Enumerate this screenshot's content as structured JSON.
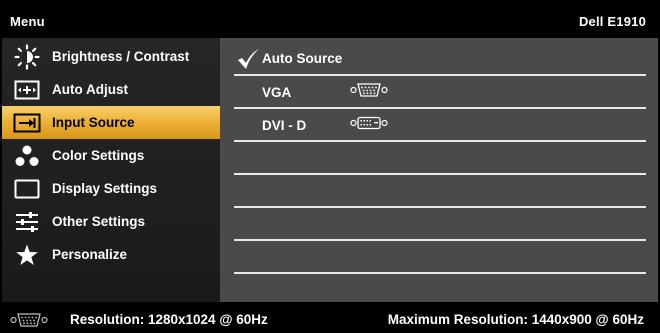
{
  "header": {
    "menu_title": "Menu",
    "model": "Dell  E1910"
  },
  "sidebar": {
    "items": [
      {
        "label": "Brightness / Contrast",
        "icon": "brightness-icon"
      },
      {
        "label": "Auto Adjust",
        "icon": "auto-adjust-icon"
      },
      {
        "label": "Input Source",
        "icon": "input-source-icon",
        "selected": true
      },
      {
        "label": "Color Settings",
        "icon": "color-settings-icon"
      },
      {
        "label": "Display Settings",
        "icon": "display-settings-icon"
      },
      {
        "label": "Other Settings",
        "icon": "other-settings-icon"
      },
      {
        "label": "Personalize",
        "icon": "star-icon"
      }
    ]
  },
  "input_source": {
    "options": [
      {
        "label": "Auto Source",
        "checked": true
      },
      {
        "label": "VGA",
        "connector_icon": "vga-connector-icon"
      },
      {
        "label": "DVI - D",
        "connector_icon": "dvi-connector-icon"
      }
    ]
  },
  "status": {
    "connector_icon": "vga-connector-icon",
    "resolution": "Resolution: 1280x1024 @ 60Hz",
    "max_resolution": "Maximum Resolution: 1440x900 @ 60Hz"
  },
  "colors": {
    "highlight": "#eeb23a",
    "content_bg": "#4a4a4a",
    "sidebar_bg": "#222222",
    "text": "#ffffff"
  }
}
